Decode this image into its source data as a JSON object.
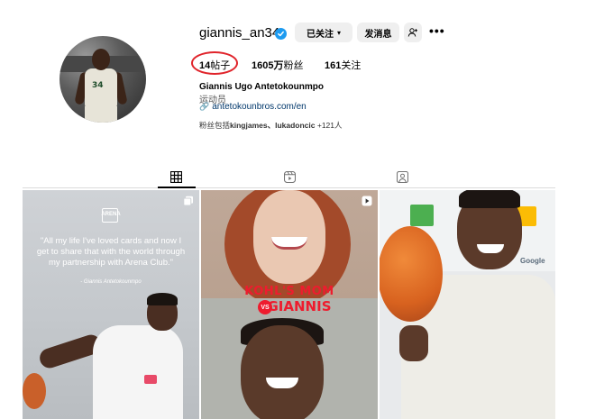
{
  "profile": {
    "username": "giannis_an34",
    "verified": true,
    "full_name": "Giannis Ugo Antetokounmpo",
    "category": "运动员",
    "link": "antetokounbros.com/en",
    "followed_by_prefix": "粉丝包括",
    "followed_by_names": "kingjames、lukadoncic",
    "followed_by_suffix": " +121人"
  },
  "actions": {
    "following_label": "已关注",
    "message_label": "发消息"
  },
  "stats": {
    "posts_count": "14",
    "posts_label": "帖子",
    "followers_count": "1605万",
    "followers_label": "粉丝",
    "following_count": "161",
    "following_label": "关注"
  },
  "tabs": [
    {
      "name": "posts-grid",
      "icon": "grid-icon",
      "active": true
    },
    {
      "name": "reels",
      "icon": "reels-icon",
      "active": false
    },
    {
      "name": "tagged",
      "icon": "tagged-icon",
      "active": false
    }
  ],
  "posts": [
    {
      "type": "carousel",
      "icon": "carousel-icon",
      "logo_text": "ARENA",
      "quote": "\"All my life I've loved cards and now I get to share that with the world through my partnership with Arena Club.\"",
      "attribution": "- Giannis Antetokounmpo"
    },
    {
      "type": "reel",
      "icon": "reel-icon",
      "title_line1": "KOHL'S MOM",
      "title_vs": "VS",
      "title_line2": "GIANNIS"
    },
    {
      "type": "photo",
      "icon": "",
      "background_text": "Google"
    }
  ],
  "colors": {
    "verified_blue": "#1d9bf0",
    "link_color": "#00376b",
    "annotation_red": "#e0242b",
    "button_bg": "#efefef",
    "title_red": "#ee1c2e"
  }
}
